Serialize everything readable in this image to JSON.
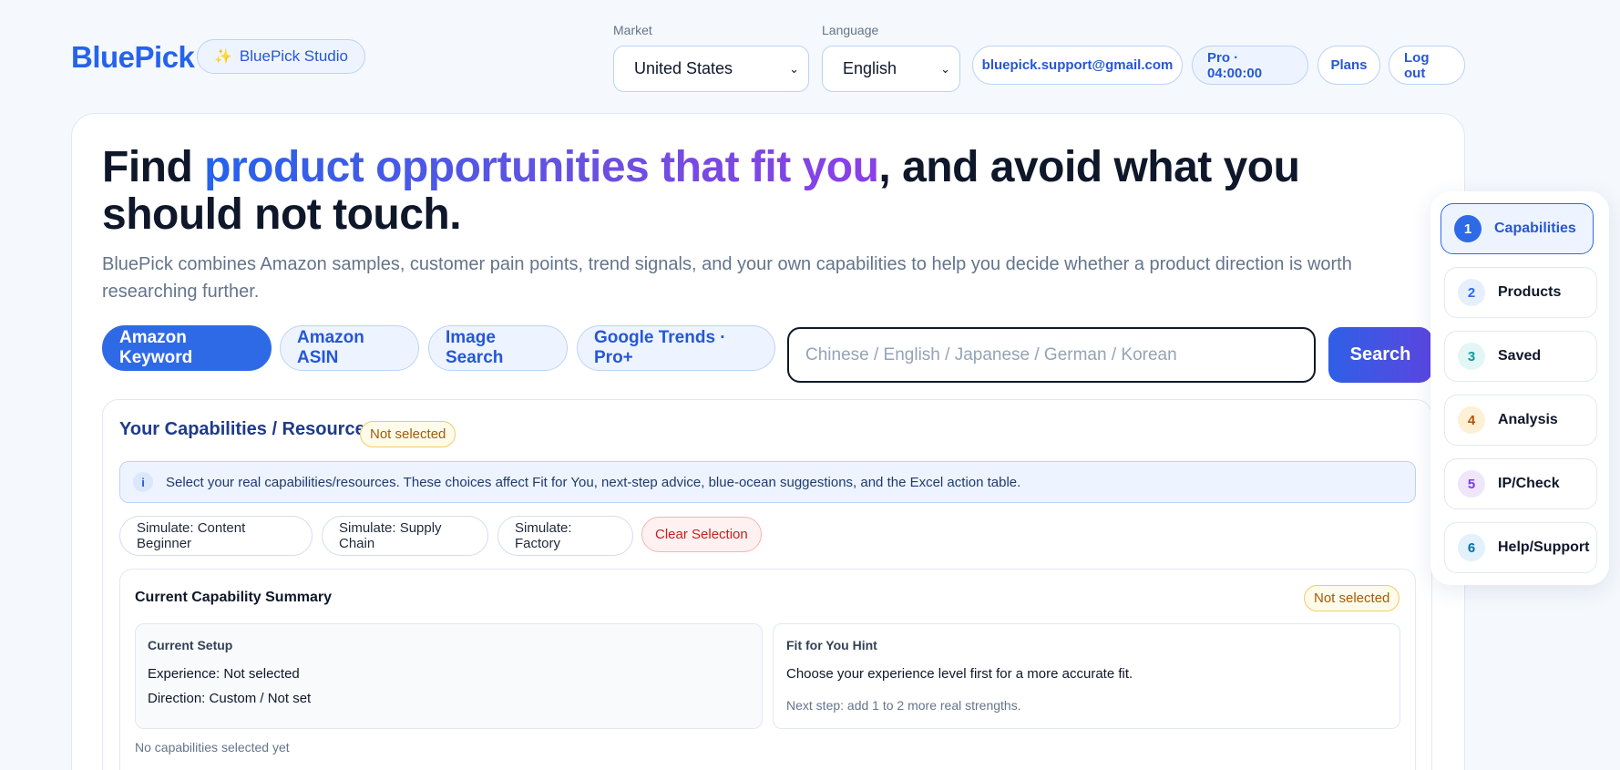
{
  "header": {
    "logo": "BluePick",
    "studio_label": "BluePick Studio",
    "market": {
      "label": "Market",
      "value": "United States"
    },
    "language": {
      "label": "Language",
      "value": "English"
    },
    "email": "bluepick.support@gmail.com",
    "plan_status": "Pro · 04:00:00",
    "plans_label": "Plans",
    "logout_label": "Log out"
  },
  "hero": {
    "headline_pre": "Find ",
    "headline_highlight": "product opportunities that fit you",
    "headline_post": ", and avoid what you should not touch.",
    "subline": "BluePick combines Amazon samples, customer pain points, trend signals, and your own capabilities to help you decide whether a product direction is worth researching further."
  },
  "search": {
    "modes": [
      "Amazon Keyword",
      "Amazon ASIN",
      "Image Search",
      "Google Trends · Pro+"
    ],
    "active_mode": 0,
    "placeholder": "Chinese / English / Japanese / German / Korean",
    "button_label": "Search"
  },
  "capabilities": {
    "title": "Your Capabilities / Resources",
    "status_badge": "Not selected",
    "info_text": "Select your real capabilities/resources. These choices affect Fit for You, next-step advice, blue-ocean suggestions, and the Excel action table.",
    "simulate_buttons": [
      "Simulate: Content Beginner",
      "Simulate: Supply Chain",
      "Simulate: Factory"
    ],
    "clear_label": "Clear Selection",
    "summary": {
      "title": "Current Capability Summary",
      "badge": "Not selected",
      "setup_title": "Current Setup",
      "setup_experience": "Experience: Not selected",
      "setup_direction": "Direction: Custom / Not set",
      "hint_title": "Fit for You Hint",
      "hint_text": "Choose your experience level first for a more accurate fit.",
      "hint_next": "Next step: add 1 to 2 more real strengths.",
      "empty_note": "No capabilities selected yet"
    }
  },
  "steps": [
    {
      "num": "1",
      "label": "Capabilities",
      "color": "#2f6ae6",
      "bg": "#2f6ae6",
      "fg": "#ffffff"
    },
    {
      "num": "2",
      "label": "Products",
      "color": "#2f6ae6",
      "bg": "#e8effc",
      "fg": "#2f6ae6"
    },
    {
      "num": "3",
      "label": "Saved",
      "color": "#0ea5a5",
      "bg": "#e3f6f6",
      "fg": "#0e9a9a"
    },
    {
      "num": "4",
      "label": "Analysis",
      "color": "#d97706",
      "bg": "#fdf0d5",
      "fg": "#b45309"
    },
    {
      "num": "5",
      "label": "IP/Check",
      "color": "#7c3aed",
      "bg": "#efe6fc",
      "fg": "#7c3aed"
    },
    {
      "num": "6",
      "label": "Help/Support",
      "color": "#0284c7",
      "bg": "#e2f1fa",
      "fg": "#0272a8"
    }
  ]
}
